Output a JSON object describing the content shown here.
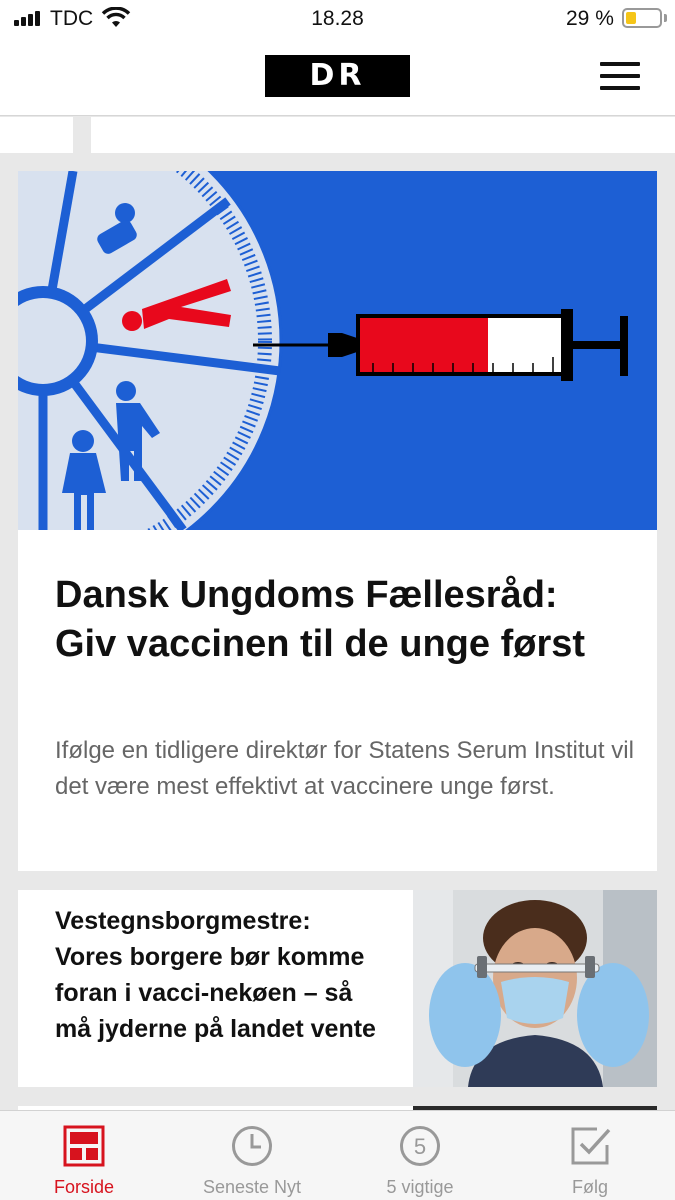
{
  "status_bar": {
    "carrier": "TDC",
    "time": "18.28",
    "battery_percent": "29 %",
    "battery_level": 0.29
  },
  "header": {
    "logo_text": "DR",
    "menu_icon": "hamburger-menu-icon"
  },
  "articles": [
    {
      "title": "Dansk Ungdoms Fællesråd: Giv vaccinen til de unge først",
      "lead": "Ifølge en tidligere direktør for Statens Serum Institut vil det være mest effektivt at vaccinere unge først.",
      "image": "vaccine-priority-illustration"
    },
    {
      "title": "Vestegnsborgmestre: Vores borgere bør komme foran i vacci-nekøen – så må jyderne på landet vente",
      "image": "person-with-vaccine-vial-photo"
    }
  ],
  "tabbar": {
    "tabs": [
      {
        "label": "Forside",
        "icon": "front-page-icon",
        "active": true
      },
      {
        "label": "Seneste Nyt",
        "icon": "clock-icon",
        "active": false
      },
      {
        "label": "5 vigtige",
        "icon": "five-circle-icon",
        "active": false
      },
      {
        "label": "Følg",
        "icon": "checkbox-icon",
        "active": false
      }
    ]
  },
  "colors": {
    "accent": "#d7131e",
    "hero_blue": "#1d5fd4",
    "battery": "#f5c518"
  }
}
